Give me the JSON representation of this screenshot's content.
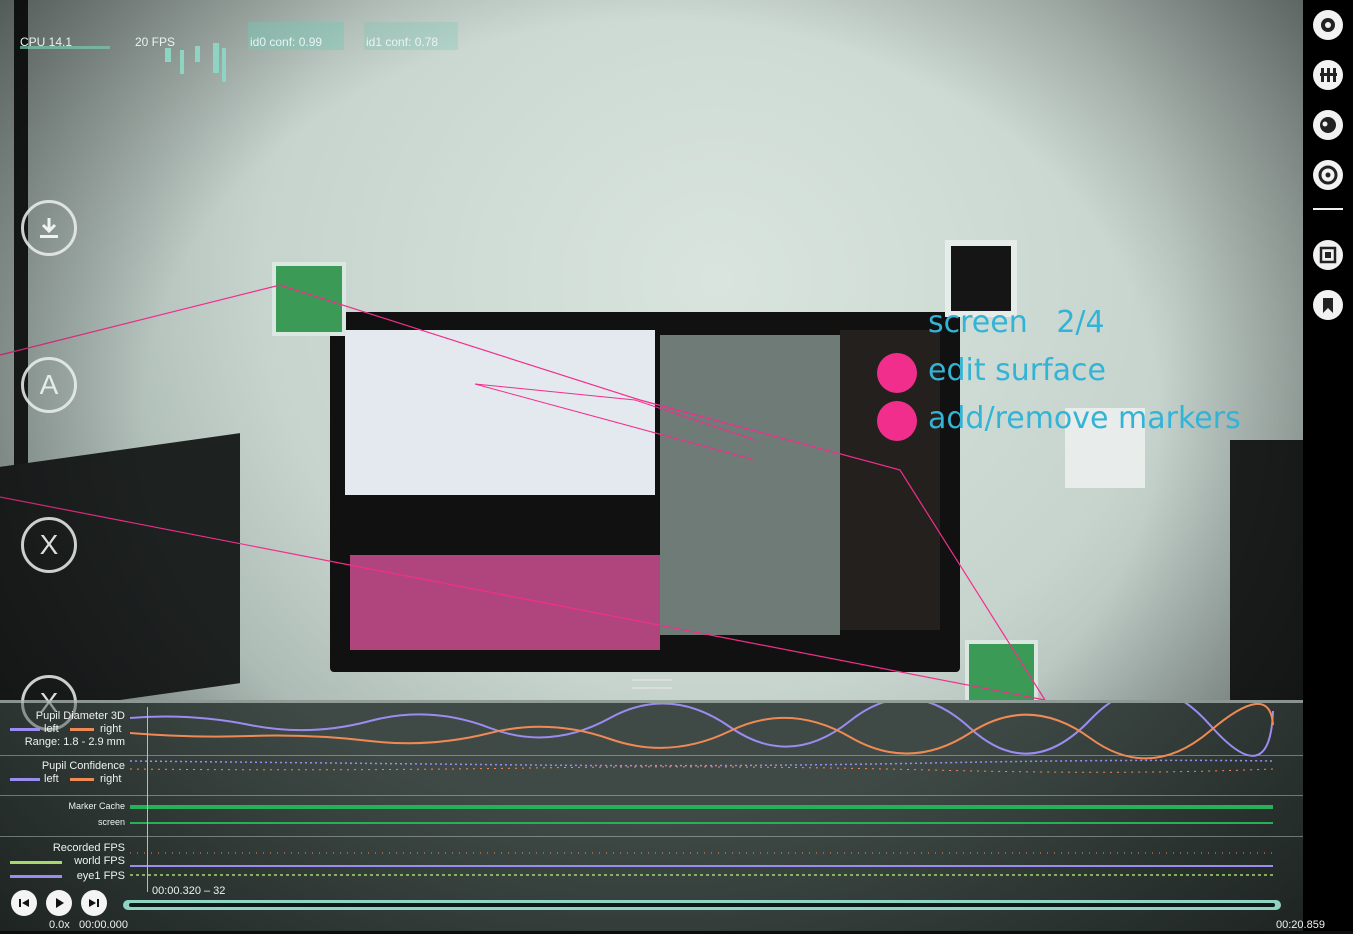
{
  "stats": {
    "cpu": "CPU 14.1",
    "fps": "20 FPS",
    "id0_conf": "id0 conf: 0.99",
    "id1_conf": "id1 conf: 0.78"
  },
  "side_buttons": [
    {
      "name": "download-button",
      "label": ""
    },
    {
      "name": "annotation-a-button",
      "label": "A"
    },
    {
      "name": "annotation-x-button-1",
      "label": "X"
    },
    {
      "name": "annotation-x-button-2",
      "label": "X"
    }
  ],
  "surface_menu": {
    "title": "screen   2/4",
    "edit": "edit surface",
    "markers": "add/remove markers",
    "accent": "#f22e8c",
    "text_color": "#33b3d6"
  },
  "toolbar": {
    "items": [
      "gear-icon",
      "sliders-icon",
      "eye-icon",
      "target-icon",
      "surface-icon",
      "bookmark-icon"
    ]
  },
  "timeline": {
    "pupil_diameter": {
      "title": "Pupil Diameter 3D",
      "left": "left",
      "right": "right",
      "range": "Range: 1.8 - 2.9 mm"
    },
    "pupil_confidence": {
      "title": "Pupil Confidence",
      "left": "left",
      "right": "right"
    },
    "marker_cache": {
      "title": "Marker Cache",
      "surface": "screen"
    },
    "fps": {
      "title": "Recorded FPS",
      "world": "world FPS",
      "eye1": "eye1 FPS"
    },
    "colors": {
      "left": "#9b8cf0",
      "right": "#f08a55",
      "marker": "#27b05a",
      "world": "#a6d86a"
    },
    "cursor": "00:00.320 – 32",
    "speed": "0.0x",
    "start": "00:00.000",
    "end": "00:20.859"
  }
}
